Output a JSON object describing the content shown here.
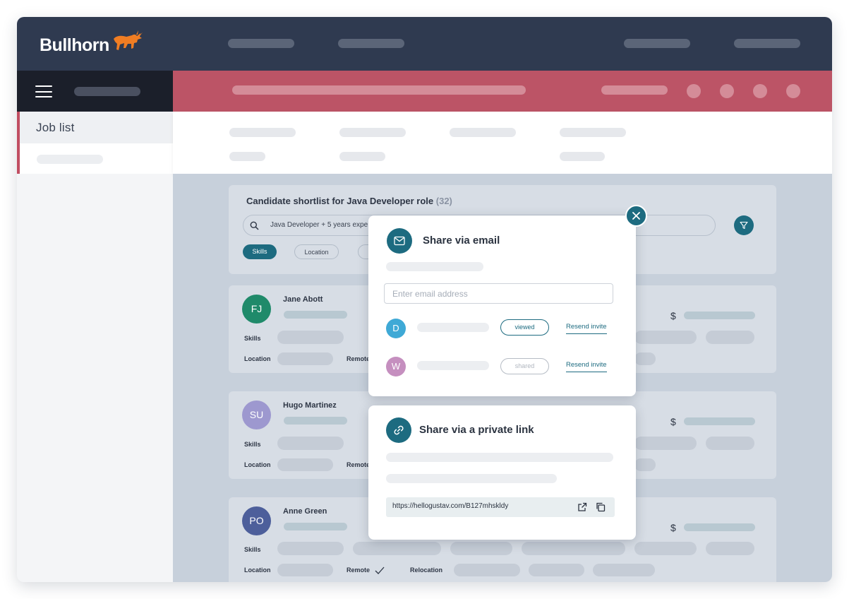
{
  "app": {
    "logo_text": "Bullhorn"
  },
  "sidebar": {
    "nav_title": "Job list"
  },
  "shortlist": {
    "title": "Candidate shortlist for Java Developer role",
    "count": "(32)",
    "search_value": "Java Developer + 5 years expe",
    "chips": [
      "Skills",
      "Location"
    ]
  },
  "candidates": [
    {
      "initials": "FJ",
      "name": "Jane Abott",
      "avatar_color": "#1f8a6a",
      "remote_check": false
    },
    {
      "initials": "SU",
      "name": "Hugo Martinez",
      "avatar_color": "#9d98cf",
      "remote_check": false
    },
    {
      "initials": "PO",
      "name": "Anne Green",
      "avatar_color": "#4d5f9b",
      "remote_check": true
    }
  ],
  "labels": {
    "skills": "Skills",
    "location": "Location",
    "remote": "Remote",
    "relocation": "Relocation",
    "dollar": "$"
  },
  "share_email": {
    "title": "Share via email",
    "placeholder": "Enter email address",
    "invites": [
      {
        "initial": "D",
        "color": "#3fa9d6",
        "status": "viewed",
        "status_color": "#1d6b80",
        "action": "Resend invite"
      },
      {
        "initial": "W",
        "color": "#c58fbf",
        "status": "shared",
        "status_color": "#b6bcc5",
        "action": "Resend invite"
      }
    ]
  },
  "share_link": {
    "title": "Share via a private link",
    "url": "https://hellogustav.com/B127mhskldy"
  },
  "colors": {
    "brand_teal": "#1d6b80",
    "topbar": "#2f3a50",
    "accent_red": "#bc5466",
    "logo_orange": "#f07d23"
  },
  "icons": [
    "menu-icon",
    "bull-logo-icon",
    "search-icon",
    "filter-icon",
    "close-icon",
    "envelope-icon",
    "link-icon",
    "external-link-icon",
    "copy-icon",
    "checkmark-icon"
  ]
}
